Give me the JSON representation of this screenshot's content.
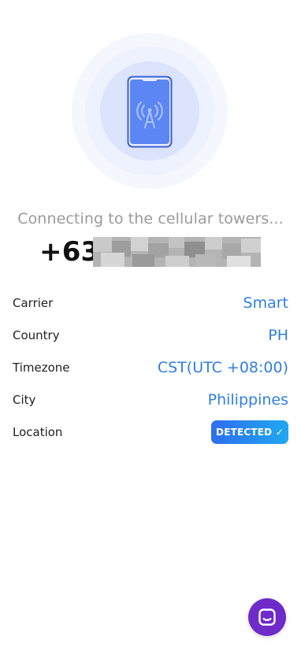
{
  "status": {
    "message": "Connecting to the cellular towers..."
  },
  "phone": {
    "prefix": "+639"
  },
  "details": [
    {
      "label": "Carrier",
      "value": "Smart"
    },
    {
      "label": "Country",
      "value": "PH"
    },
    {
      "label": "Timezone",
      "value": "CST(UTC +08:00)"
    },
    {
      "label": "City",
      "value": "Philippines"
    }
  ],
  "location": {
    "label": "Location",
    "badge": "DETECTED ✓"
  },
  "colors": {
    "accent": "#2f7fe3",
    "chat": "#6e2bc9",
    "phone_body": "#5b86f3"
  },
  "icons": {
    "hero": "phone-antenna-icon",
    "chat": "chat-icon"
  }
}
